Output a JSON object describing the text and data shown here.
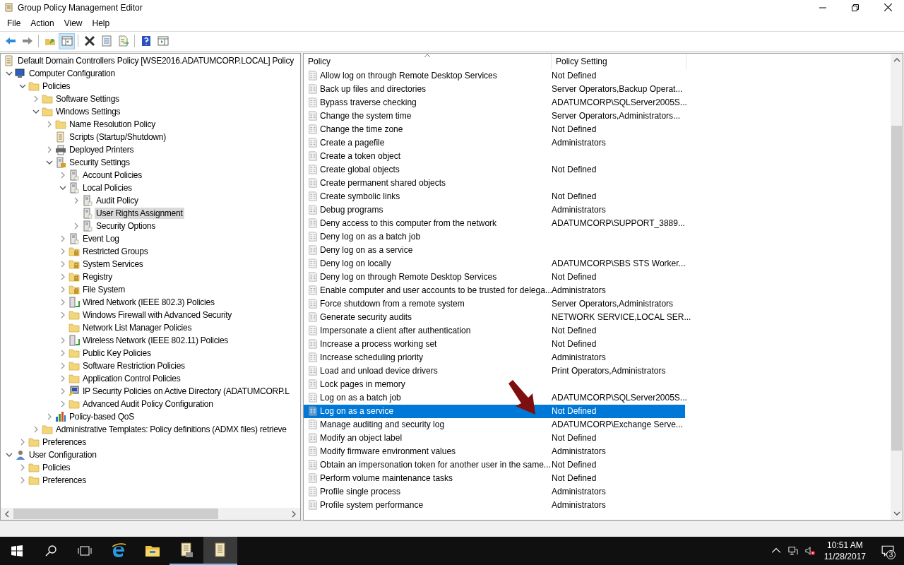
{
  "window": {
    "title": "Group Policy Management Editor"
  },
  "menu": [
    "File",
    "Action",
    "View",
    "Help"
  ],
  "toolbar": {
    "show_tree_pressed": true
  },
  "tree": {
    "label": "Default Domain Controllers Policy [WSE2016.ADATUMCORP.LOCAL] Policy",
    "kind": "policy",
    "selected": false,
    "children": [
      {
        "label": "Computer Configuration",
        "kind": "computer",
        "expanded": true,
        "selected": false,
        "children": [
          {
            "label": "Policies",
            "kind": "folder",
            "expanded": true,
            "selected": false,
            "children": [
              {
                "label": "Software Settings",
                "kind": "folder",
                "expanded": false,
                "selected": false
              },
              {
                "label": "Windows Settings",
                "kind": "folder",
                "expanded": true,
                "selected": false,
                "children": [
                  {
                    "label": "Name Resolution Policy",
                    "kind": "folder",
                    "expanded": false,
                    "selected": false
                  },
                  {
                    "label": "Scripts (Startup/Shutdown)",
                    "kind": "script",
                    "selected": false
                  },
                  {
                    "label": "Deployed Printers",
                    "kind": "printer",
                    "expanded": false,
                    "selected": false
                  },
                  {
                    "label": "Security Settings",
                    "kind": "security",
                    "expanded": true,
                    "selected": false,
                    "children": [
                      {
                        "label": "Account Policies",
                        "kind": "server",
                        "expanded": false,
                        "selected": false
                      },
                      {
                        "label": "Local Policies",
                        "kind": "server",
                        "expanded": true,
                        "selected": false,
                        "children": [
                          {
                            "label": "Audit Policy",
                            "kind": "server",
                            "expanded": false,
                            "selected": false
                          },
                          {
                            "label": "User Rights Assignment",
                            "kind": "server",
                            "selected": true
                          },
                          {
                            "label": "Security Options",
                            "kind": "server",
                            "expanded": false,
                            "selected": false
                          }
                        ]
                      },
                      {
                        "label": "Event Log",
                        "kind": "server",
                        "expanded": false,
                        "selected": false
                      },
                      {
                        "label": "Restricted Groups",
                        "kind": "lockfolder",
                        "expanded": false,
                        "selected": false
                      },
                      {
                        "label": "System Services",
                        "kind": "lockfolder",
                        "expanded": false,
                        "selected": false
                      },
                      {
                        "label": "Registry",
                        "kind": "lockfolder",
                        "expanded": false,
                        "selected": false
                      },
                      {
                        "label": "File System",
                        "kind": "lockfolder",
                        "expanded": false,
                        "selected": false
                      },
                      {
                        "label": "Wired Network (IEEE 802.3) Policies",
                        "kind": "network",
                        "expanded": false,
                        "selected": false
                      },
                      {
                        "label": "Windows Firewall with Advanced Security",
                        "kind": "folder",
                        "expanded": false,
                        "selected": false
                      },
                      {
                        "label": "Network List Manager Policies",
                        "kind": "folder",
                        "selected": false
                      },
                      {
                        "label": "Wireless Network (IEEE 802.11) Policies",
                        "kind": "wireless",
                        "expanded": false,
                        "selected": false
                      },
                      {
                        "label": "Public Key Policies",
                        "kind": "folder",
                        "expanded": false,
                        "selected": false
                      },
                      {
                        "label": "Software Restriction Policies",
                        "kind": "folder",
                        "expanded": false,
                        "selected": false
                      },
                      {
                        "label": "Application Control Policies",
                        "kind": "folder",
                        "expanded": false,
                        "selected": false
                      },
                      {
                        "label": "IP Security Policies on Active Directory (ADATUMCORP.L",
                        "kind": "ipsec",
                        "expanded": false,
                        "selected": false
                      },
                      {
                        "label": "Advanced Audit Policy Configuration",
                        "kind": "folder",
                        "expanded": false,
                        "selected": false
                      }
                    ]
                  },
                  {
                    "label": "Policy-based QoS",
                    "kind": "qos",
                    "expanded": false,
                    "selected": false
                  }
                ]
              },
              {
                "label": "Administrative Templates: Policy definitions (ADMX files) retrieve",
                "kind": "folder",
                "expanded": false,
                "selected": false
              }
            ]
          },
          {
            "label": "Preferences",
            "kind": "folder",
            "expanded": false,
            "selected": false
          }
        ]
      },
      {
        "label": "User Configuration",
        "kind": "user",
        "expanded": true,
        "selected": false,
        "children": [
          {
            "label": "Policies",
            "kind": "folder",
            "expanded": false,
            "selected": false
          },
          {
            "label": "Preferences",
            "kind": "folder",
            "expanded": false,
            "selected": false
          }
        ]
      }
    ]
  },
  "list": {
    "columns": [
      "Policy",
      "Policy Setting"
    ],
    "rows": [
      {
        "policy": "Allow log on through Remote Desktop Services",
        "setting": "Not Defined",
        "selected": false
      },
      {
        "policy": "Back up files and directories",
        "setting": "Server Operators,Backup Operat...",
        "selected": false
      },
      {
        "policy": "Bypass traverse checking",
        "setting": "ADATUMCORP\\SQLServer2005S...",
        "selected": false
      },
      {
        "policy": "Change the system time",
        "setting": "Server Operators,Administrators...",
        "selected": false
      },
      {
        "policy": "Change the time zone",
        "setting": "Not Defined",
        "selected": false
      },
      {
        "policy": "Create a pagefile",
        "setting": "Administrators",
        "selected": false
      },
      {
        "policy": "Create a token object",
        "selected": false
      },
      {
        "policy": "Create global objects",
        "setting": "Not Defined",
        "selected": false
      },
      {
        "policy": "Create permanent shared objects",
        "selected": false
      },
      {
        "policy": "Create symbolic links",
        "setting": "Not Defined",
        "selected": false
      },
      {
        "policy": "Debug programs",
        "setting": "Administrators",
        "selected": false
      },
      {
        "policy": "Deny access to this computer from the network",
        "setting": "ADATUMCORP\\SUPPORT_3889...",
        "selected": false
      },
      {
        "policy": "Deny log on as a batch job",
        "selected": false
      },
      {
        "policy": "Deny log on as a service",
        "selected": false
      },
      {
        "policy": "Deny log on locally",
        "setting": "ADATUMCORP\\SBS STS Worker...",
        "selected": false
      },
      {
        "policy": "Deny log on through Remote Desktop Services",
        "setting": "Not Defined",
        "selected": false
      },
      {
        "policy": "Enable computer and user accounts to be trusted for delega...",
        "setting": "Administrators",
        "selected": false
      },
      {
        "policy": "Force shutdown from a remote system",
        "setting": "Server Operators,Administrators",
        "selected": false
      },
      {
        "policy": "Generate security audits",
        "setting": "NETWORK SERVICE,LOCAL SER...",
        "selected": false
      },
      {
        "policy": "Impersonate a client after authentication",
        "setting": "Not Defined",
        "selected": false
      },
      {
        "policy": "Increase a process working set",
        "setting": "Not Defined",
        "selected": false
      },
      {
        "policy": "Increase scheduling priority",
        "setting": "Administrators",
        "selected": false
      },
      {
        "policy": "Load and unload device drivers",
        "setting": "Print Operators,Administrators",
        "selected": false
      },
      {
        "policy": "Lock pages in memory",
        "selected": false
      },
      {
        "policy": "Log on as a batch job",
        "setting": "ADATUMCORP\\SQLServer2005S...",
        "selected": false
      },
      {
        "policy": "Log on as a service",
        "setting": "Not Defined",
        "selected": true
      },
      {
        "policy": "Manage auditing and security log",
        "setting": "ADATUMCORP\\Exchange Serve...",
        "selected": false
      },
      {
        "policy": "Modify an object label",
        "setting": "Not Defined",
        "selected": false
      },
      {
        "policy": "Modify firmware environment values",
        "setting": "Administrators",
        "selected": false
      },
      {
        "policy": "Obtain an impersonation token for another user in the same...",
        "setting": "Not Defined",
        "selected": false
      },
      {
        "policy": "Perform volume maintenance tasks",
        "setting": "Not Defined",
        "selected": false
      },
      {
        "policy": "Profile single process",
        "setting": "Administrators",
        "selected": false
      },
      {
        "policy": "Profile system performance",
        "setting": "Administrators",
        "selected": false
      }
    ]
  },
  "taskbar": {
    "time": "10:51 AM",
    "date": "11/28/2017",
    "notifications": "3"
  }
}
